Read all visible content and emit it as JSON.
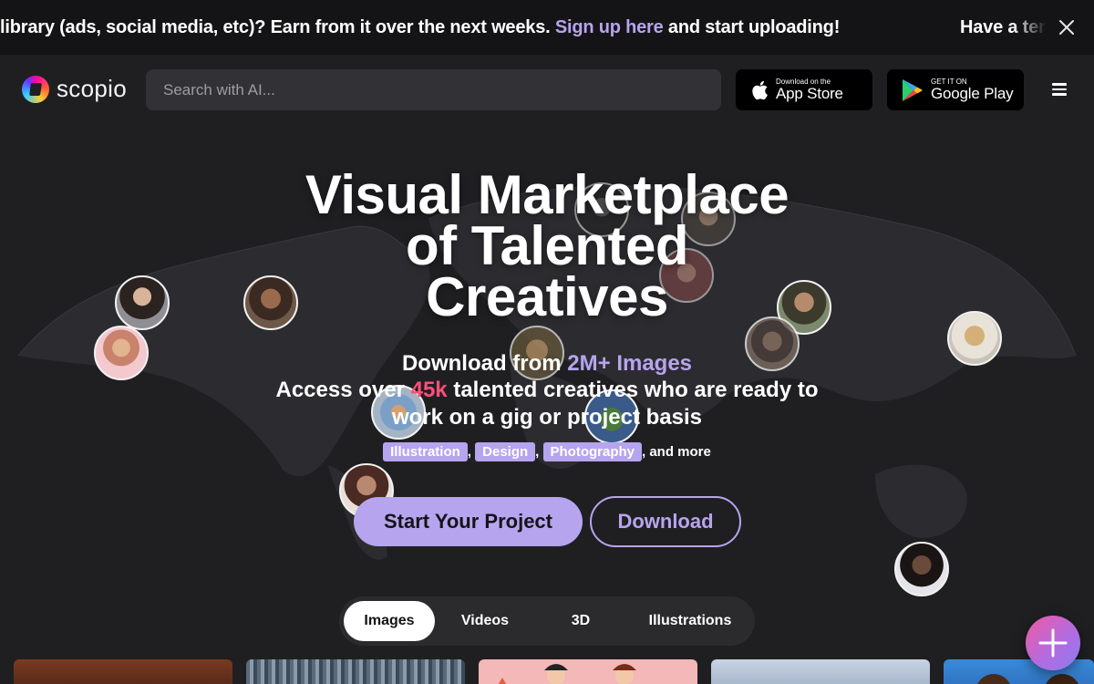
{
  "banner": {
    "text_before": "library (ads, social media, etc)? Earn from it over the next weeks. ",
    "link_text": "Sign up here",
    "text_after": " and start uploading!",
    "tail_text": "Have a ter"
  },
  "header": {
    "logo_text": "scopio",
    "search_placeholder": "Search with AI...",
    "app_store": {
      "small": "Download on the",
      "big": "App Store"
    },
    "google_play": {
      "small": "GET IT ON",
      "big": "Google Play"
    }
  },
  "hero": {
    "title_line1": "Visual Marketplace",
    "title_line2": "of Talented",
    "title_line3": "Creatives",
    "sub1_prefix": "Download from ",
    "sub1_highlight": "2M+ Images",
    "sub2_prefix": "Access over ",
    "sub2_highlight": "45k",
    "sub2_suffix": " talented creatives who are ready to work on a gig or project basis",
    "tags": [
      "Illustration",
      "Design",
      "Photography"
    ],
    "tags_suffix": ", and more",
    "primary_button": "Start Your Project",
    "secondary_button": "Download"
  },
  "tabs": [
    {
      "label": "Images",
      "active": true
    },
    {
      "label": "Videos",
      "active": false
    },
    {
      "label": "3D",
      "active": false
    },
    {
      "label": "Illustrations",
      "active": false
    }
  ],
  "colors": {
    "accent": "#b7a4ef",
    "highlight_pink": "#ff4f78",
    "background": "#1f1f22",
    "banner_bg": "#141416"
  }
}
